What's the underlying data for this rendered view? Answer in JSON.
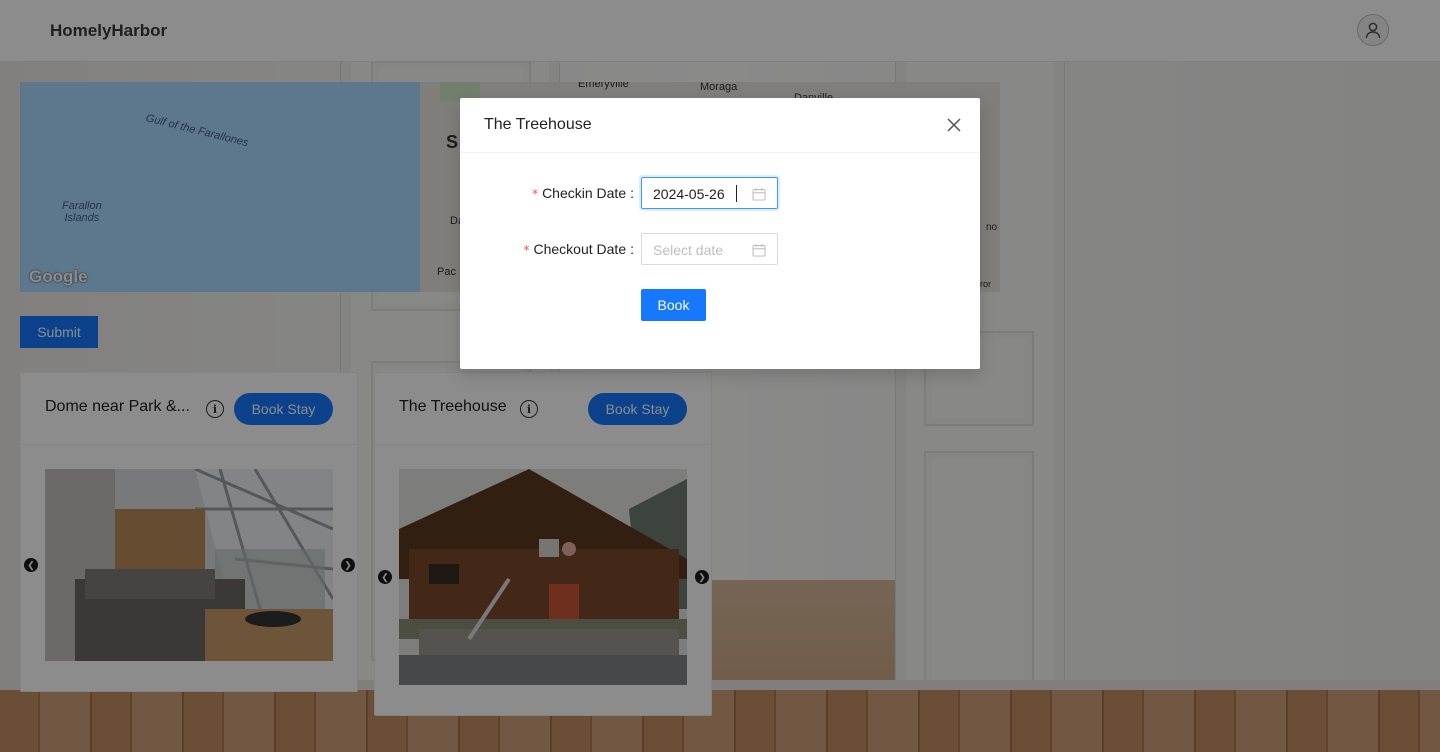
{
  "header": {
    "brand": "HomelyHarbor"
  },
  "map": {
    "labels": {
      "gulf": "Gulf of the Farallones",
      "islands_line1": "Farallon",
      "islands_line2": "Islands",
      "emeryville": "Emeryville",
      "moraga": "Moraga",
      "danville": "Danville",
      "sf_letter": "S",
      "da": "Da",
      "pac": "Pac",
      "no": "no",
      "rror": "rror"
    },
    "google": "Google"
  },
  "submit_label": "Submit",
  "cards": [
    {
      "title": "Dome near Park &...",
      "info": "i",
      "button": "Book Stay"
    },
    {
      "title": "The Treehouse",
      "info": "i",
      "button": "Book Stay"
    }
  ],
  "modal": {
    "title": "The Treehouse",
    "checkin": {
      "label": "Checkin Date",
      "colon": ":",
      "value": "2024-05-26"
    },
    "checkout": {
      "label": "Checkout Date",
      "colon": ":",
      "placeholder": "Select date"
    },
    "required_mark": "*",
    "book_label": "Book"
  },
  "colors": {
    "primary": "#1677ff",
    "required": "#ff4d4f"
  }
}
